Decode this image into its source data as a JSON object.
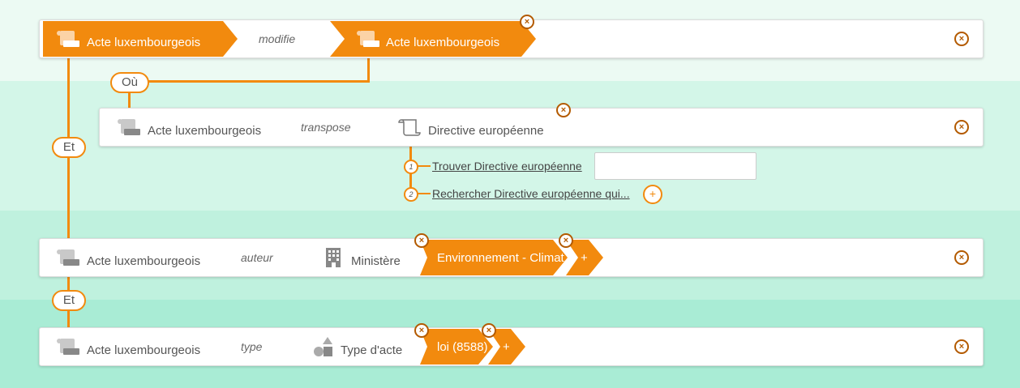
{
  "colors": {
    "accent": "#f28a0e",
    "dark_accent": "#b35a00"
  },
  "connectors": {
    "or": "Où",
    "and1": "Et",
    "and2": "Et"
  },
  "row1": {
    "subject": "Acte luxembourgeois",
    "verb": "modifie",
    "object": "Acte luxembourgeois"
  },
  "row2": {
    "subject": "Acte luxembourgeois",
    "verb": "transpose",
    "object": "Directive européenne",
    "option1": "Trouver Directive européenne",
    "option2": "Rechercher Directive européenne qui...",
    "option1_num": "1",
    "option2_num": "2",
    "search_value": ""
  },
  "row3": {
    "subject": "Acte luxembourgeois",
    "verb": "auteur",
    "object": "Ministère",
    "value": "Environnement - Climat",
    "add": "+"
  },
  "row4": {
    "subject": "Acte luxembourgeois",
    "verb": "type",
    "object": "Type d'acte",
    "value": "loi (8588)",
    "add": "+"
  },
  "icons": {
    "acte": "scroll-icon",
    "directive": "scroll-outline-icon",
    "ministere": "building-icon",
    "type": "shapes-icon",
    "close": "close-circle-icon",
    "add": "plus-circle-icon"
  }
}
